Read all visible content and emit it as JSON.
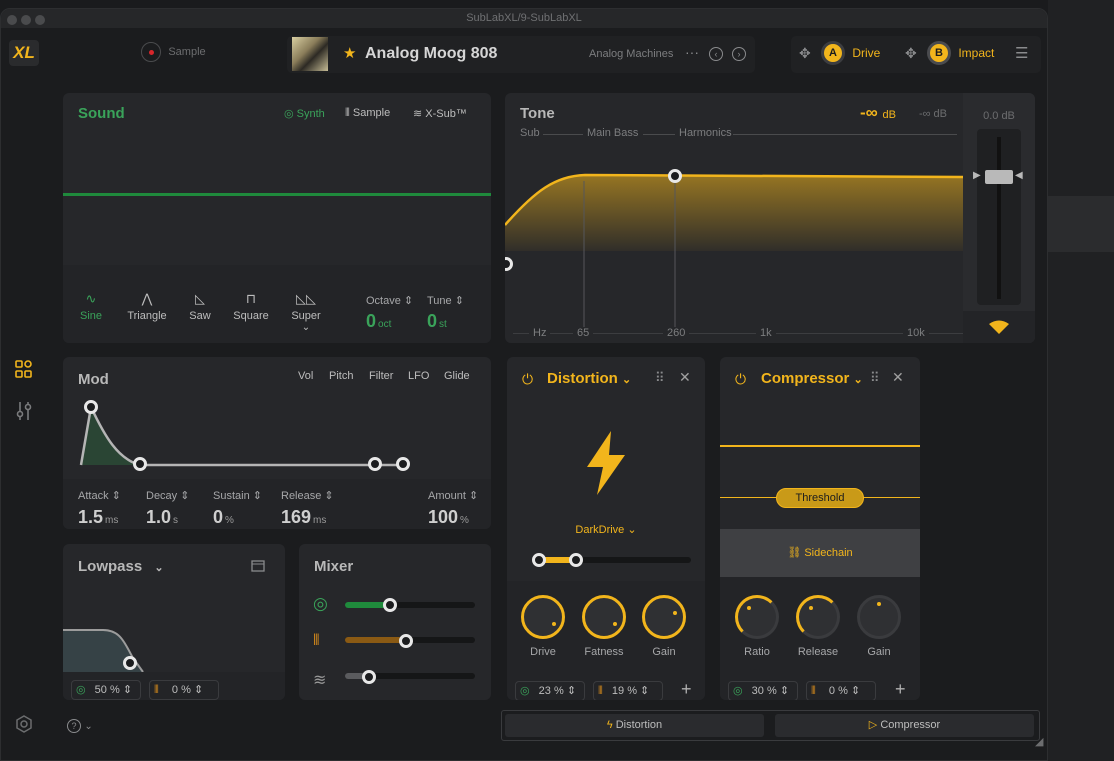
{
  "window": {
    "title": "SubLabXL/9-SubLabXL"
  },
  "header": {
    "logo": "XL",
    "sample_label": "Sample",
    "preset_name": "Analog Moog 808",
    "preset_category": "Analog Machines",
    "more": "···",
    "fx_slots": [
      {
        "badge": "A",
        "label": "Drive"
      },
      {
        "badge": "B",
        "label": "Impact"
      }
    ]
  },
  "sound": {
    "title": "Sound",
    "tabs": [
      "Synth",
      "Sample",
      "X-Sub™"
    ],
    "waves": [
      "Sine",
      "Triangle",
      "Saw",
      "Square",
      "Super"
    ],
    "octave": {
      "label": "Octave",
      "value": "0",
      "unit": "oct"
    },
    "tune": {
      "label": "Tune",
      "value": "0",
      "unit": "st"
    }
  },
  "tone": {
    "title": "Tone",
    "level": "-∞",
    "level_unit": "dB",
    "level_right": "-∞ dB",
    "bands": [
      "Sub",
      "Main Bass",
      "Harmonics"
    ],
    "freq_labels": [
      "Hz",
      "65",
      "260",
      "1k",
      "10k"
    ],
    "fader_db": "0.0 dB"
  },
  "mod": {
    "title": "Mod",
    "tabs": [
      "Vol",
      "Pitch",
      "Filter",
      "LFO",
      "Glide"
    ],
    "params": [
      {
        "label": "Attack",
        "value": "1.5",
        "unit": "ms"
      },
      {
        "label": "Decay",
        "value": "1.0",
        "unit": "s"
      },
      {
        "label": "Sustain",
        "value": "0",
        "unit": "%"
      },
      {
        "label": "Release",
        "value": "169",
        "unit": "ms"
      },
      {
        "label": "Amount",
        "value": "100",
        "unit": "%"
      }
    ]
  },
  "filter": {
    "title": "Lowpass",
    "synth_pct": "50 %",
    "sample_pct": "0 %"
  },
  "mixer": {
    "title": "Mixer",
    "levels": [
      0.35,
      0.48,
      0.18
    ]
  },
  "distortion": {
    "title": "Distortion",
    "type": "DarkDrive",
    "knobs": [
      "Drive",
      "Fatness",
      "Gain"
    ],
    "synth_pct": "23 %",
    "sample_pct": "19 %"
  },
  "compressor": {
    "title": "Compressor",
    "threshold": "Threshold",
    "sidechain": "Sidechain",
    "knobs": [
      "Ratio",
      "Release",
      "Gain"
    ],
    "synth_pct": "30 %",
    "sample_pct": "0 %"
  },
  "footer": {
    "tabs": [
      "Distortion",
      "Compressor"
    ]
  },
  "colors": {
    "accent": "#f2b51c",
    "green": "#3aa35a",
    "panel": "#26272a",
    "bg": "#1b1c1e"
  }
}
